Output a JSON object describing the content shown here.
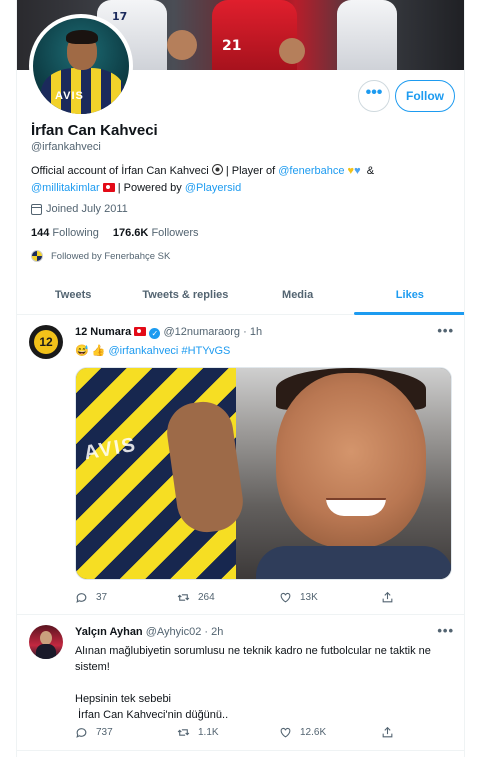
{
  "profile": {
    "name": "İrfan Can Kahveci",
    "handle": "@irfankahveci",
    "bio": {
      "part1": "Official account of İrfan Can Kahveci",
      "part2": "| Player of",
      "link1": "@fenerbahce",
      "part3": "&",
      "link2": "@millitakimlar",
      "part4": "| Powered by",
      "link3": "@Playersid"
    },
    "joined": "Joined July 2011",
    "following_count": "144",
    "following_label": "Following",
    "followers_count": "176.6K",
    "followers_label": "Followers",
    "followed_by": "Followed by Fenerbahçe SK",
    "avatar_text": "AVIS",
    "banner_numbers": [
      "17",
      "21"
    ]
  },
  "buttons": {
    "more": "•••",
    "follow": "Follow"
  },
  "tabs": [
    "Tweets",
    "Tweets & replies",
    "Media",
    "Likes"
  ],
  "tweets": [
    {
      "name": "12 Numara",
      "handle_time": "@12numaraorg · 1h",
      "text_emoji": "😅 👍",
      "mention": "@irfankahveci",
      "hashtag": "#HTYvGS",
      "avatar_text": "12",
      "media_text": "AVIS",
      "replies": "37",
      "retweets": "264",
      "likes": "13K"
    },
    {
      "name": "Yalçın Ayhan",
      "handle_time": "@Ayhyic02 · 2h",
      "line1": "Alınan mağlubiyetin sorumlusu ne teknik kadro ne futbolcular ne taktik ne",
      "line2": "sistem!",
      "line3": "Hepsinin tek sebebi",
      "line4": " İrfan Can Kahveci'nin düğünü..",
      "replies": "737",
      "retweets": "1.1K",
      "likes": "12.6K"
    }
  ],
  "colors": {
    "accent": "#1d9bf0",
    "secondary_text": "#536471",
    "primary_text": "#0f1419",
    "border": "#eff3f4"
  },
  "icons": {
    "reply": "reply-icon",
    "retweet": "retweet-icon",
    "like": "heart-icon",
    "share": "share-icon"
  }
}
